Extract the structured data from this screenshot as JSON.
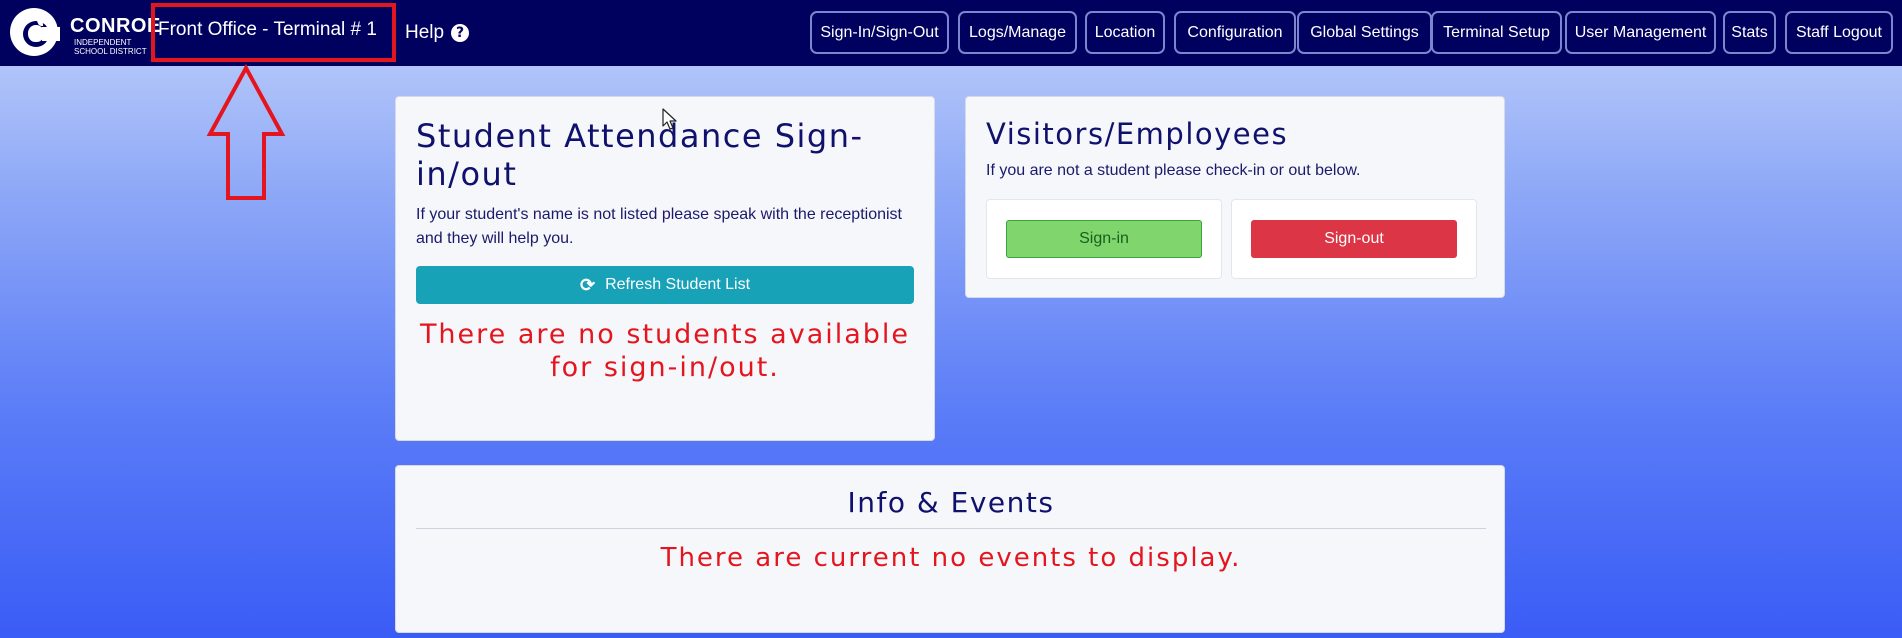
{
  "header": {
    "logo": {
      "name": "CONROE",
      "sub_line1": "INDEPENDENT",
      "sub_line2": "SCHOOL DISTRICT"
    },
    "terminal_title": "Front Office - Terminal # 1",
    "help_label": "Help",
    "nav_buttons": [
      "Sign-In/Sign-Out",
      "Logs/Manage",
      "Location",
      "Configuration",
      "Global Settings",
      "Terminal Setup",
      "User Management",
      "Stats",
      "Staff Logout"
    ]
  },
  "student_card": {
    "title": "Student Attendance Sign-in/out",
    "description": "If your student's name is not listed please speak with the receptionist and they will help you.",
    "refresh_label": "Refresh Student List",
    "empty_message": "There are no students available for sign-in/out."
  },
  "visitor_card": {
    "title": "Visitors/Employees",
    "description": "If you are not a student please check-in or out below.",
    "signin_label": "Sign-in",
    "signout_label": "Sign-out"
  },
  "events_card": {
    "title": "Info & Events",
    "empty_message": "There are current no events to display."
  },
  "colors": {
    "navbar": "#00005e",
    "highlight": "#e3161f",
    "refresh_button": "#17a2b8",
    "signin_button": "#80d66c",
    "signout_button": "#dc3545",
    "message_red": "#e3161f"
  }
}
